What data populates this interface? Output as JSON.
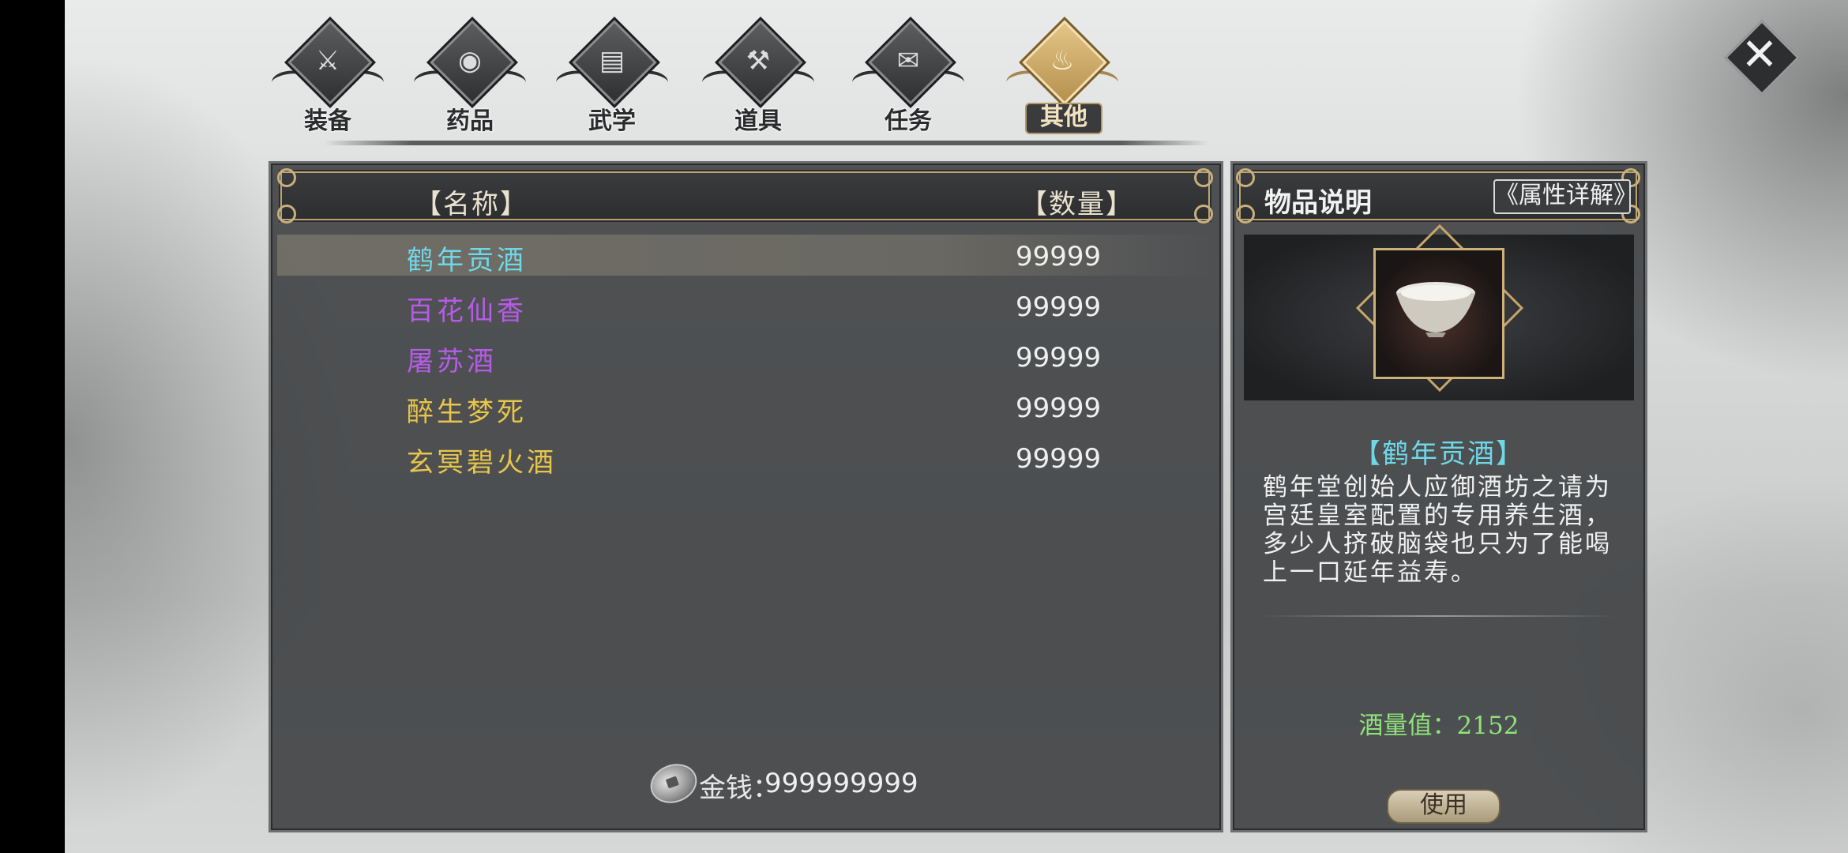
{
  "tabs": [
    {
      "label": "装备",
      "icon": "armor-icon",
      "glyph": "⚔",
      "active": false
    },
    {
      "label": "药品",
      "icon": "potion-icon",
      "glyph": "◉",
      "active": false
    },
    {
      "label": "武学",
      "icon": "book-icon",
      "glyph": "▤",
      "active": false
    },
    {
      "label": "道具",
      "icon": "tool-icon",
      "glyph": "⚒",
      "active": false
    },
    {
      "label": "任务",
      "icon": "scroll-icon",
      "glyph": "✉",
      "active": false
    },
    {
      "label": "其他",
      "icon": "flame-icon",
      "glyph": "♨",
      "active": true
    }
  ],
  "close_glyph": "✕",
  "list": {
    "col_name": "【名称】",
    "col_qty": "【数量】",
    "items": [
      {
        "name": "鹤年贡酒",
        "qty": "99999",
        "color": "#6fd8e8",
        "selected": true
      },
      {
        "name": "百花仙香",
        "qty": "99999",
        "color": "#b55ce6",
        "selected": false
      },
      {
        "name": "屠苏酒",
        "qty": "99999",
        "color": "#b55ce6",
        "selected": false
      },
      {
        "name": "醉生梦死",
        "qty": "99999",
        "color": "#e8c64a",
        "selected": false
      },
      {
        "name": "玄冥碧火酒",
        "qty": "99999",
        "color": "#e8c64a",
        "selected": false
      }
    ],
    "money_label": "金钱：",
    "money_value": "999999999"
  },
  "desc": {
    "title": "物品说明",
    "attr_button": "《属性详解》",
    "item_name": "【鹤年贡酒】",
    "text": "鹤年堂创始人应御酒坊之请为宫廷皇室配置的专用养生酒，多少人挤破脑袋也只为了能喝上一口延年益寿。",
    "stat": "酒量值：2152",
    "use_button": "使用"
  }
}
